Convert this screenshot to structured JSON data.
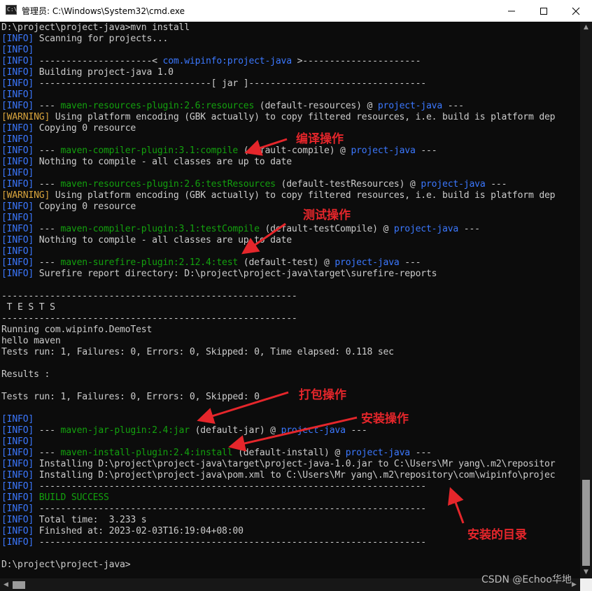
{
  "window": {
    "title": "管理员: C:\\Windows\\System32\\cmd.exe",
    "icon_label": "C:\\",
    "controls": [
      "minimize-icon",
      "maximize-icon",
      "close-icon"
    ]
  },
  "console": {
    "lines": [
      [
        {
          "t": "D:\\project\\project-java>mvn install",
          "c": ""
        }
      ],
      [
        {
          "t": "[INFO]",
          "c": "bl"
        },
        {
          "t": " Scanning for projects...",
          "c": ""
        }
      ],
      [
        {
          "t": "[INFO]",
          "c": "bl"
        }
      ],
      [
        {
          "t": "[INFO]",
          "c": "bl"
        },
        {
          "t": " ---------------------< ",
          "c": ""
        },
        {
          "t": "com.wipinfo:project-java",
          "c": "bl"
        },
        {
          "t": " >----------------------",
          "c": ""
        }
      ],
      [
        {
          "t": "[INFO]",
          "c": "bl"
        },
        {
          "t": " Building project-java 1.0",
          "c": ""
        }
      ],
      [
        {
          "t": "[INFO]",
          "c": "bl"
        },
        {
          "t": " --------------------------------[ jar ]---------------------------------",
          "c": ""
        }
      ],
      [
        {
          "t": "[INFO]",
          "c": "bl"
        }
      ],
      [
        {
          "t": "[INFO]",
          "c": "bl"
        },
        {
          "t": " --- ",
          "c": ""
        },
        {
          "t": "maven-resources-plugin:2.6:resources",
          "c": "gr"
        },
        {
          "t": " (default-resources) @ ",
          "c": ""
        },
        {
          "t": "project-java",
          "c": "bl"
        },
        {
          "t": " ---",
          "c": ""
        }
      ],
      [
        {
          "t": "[WARNING]",
          "c": "or"
        },
        {
          "t": " Using platform encoding (GBK actually) to copy filtered resources, i.e. build is platform dep",
          "c": ""
        }
      ],
      [
        {
          "t": "[INFO]",
          "c": "bl"
        },
        {
          "t": " Copying 0 resource",
          "c": ""
        }
      ],
      [
        {
          "t": "[INFO]",
          "c": "bl"
        }
      ],
      [
        {
          "t": "[INFO]",
          "c": "bl"
        },
        {
          "t": " --- ",
          "c": ""
        },
        {
          "t": "maven-compiler-plugin:3.1:compile",
          "c": "gr"
        },
        {
          "t": " (default-compile) @ ",
          "c": ""
        },
        {
          "t": "project-java",
          "c": "bl"
        },
        {
          "t": " ---",
          "c": ""
        }
      ],
      [
        {
          "t": "[INFO]",
          "c": "bl"
        },
        {
          "t": " Nothing to compile - all classes are up to date",
          "c": ""
        }
      ],
      [
        {
          "t": "[INFO]",
          "c": "bl"
        }
      ],
      [
        {
          "t": "[INFO]",
          "c": "bl"
        },
        {
          "t": " --- ",
          "c": ""
        },
        {
          "t": "maven-resources-plugin:2.6:testResources",
          "c": "gr"
        },
        {
          "t": " (default-testResources) @ ",
          "c": ""
        },
        {
          "t": "project-java",
          "c": "bl"
        },
        {
          "t": " ---",
          "c": ""
        }
      ],
      [
        {
          "t": "[WARNING]",
          "c": "or"
        },
        {
          "t": " Using platform encoding (GBK actually) to copy filtered resources, i.e. build is platform dep",
          "c": ""
        }
      ],
      [
        {
          "t": "[INFO]",
          "c": "bl"
        },
        {
          "t": " Copying 0 resource",
          "c": ""
        }
      ],
      [
        {
          "t": "[INFO]",
          "c": "bl"
        }
      ],
      [
        {
          "t": "[INFO]",
          "c": "bl"
        },
        {
          "t": " --- ",
          "c": ""
        },
        {
          "t": "maven-compiler-plugin:3.1:testCompile",
          "c": "gr"
        },
        {
          "t": " (default-testCompile) @ ",
          "c": ""
        },
        {
          "t": "project-java",
          "c": "bl"
        },
        {
          "t": " ---",
          "c": ""
        }
      ],
      [
        {
          "t": "[INFO]",
          "c": "bl"
        },
        {
          "t": " Nothing to compile - all classes are up to date",
          "c": ""
        }
      ],
      [
        {
          "t": "[INFO]",
          "c": "bl"
        }
      ],
      [
        {
          "t": "[INFO]",
          "c": "bl"
        },
        {
          "t": " --- ",
          "c": ""
        },
        {
          "t": "maven-surefire-plugin:2.12.4:test",
          "c": "gr"
        },
        {
          "t": " (default-test) @ ",
          "c": ""
        },
        {
          "t": "project-java",
          "c": "bl"
        },
        {
          "t": " ---",
          "c": ""
        }
      ],
      [
        {
          "t": "[INFO]",
          "c": "bl"
        },
        {
          "t": " Surefire report directory: D:\\project\\project-java\\target\\surefire-reports",
          "c": ""
        }
      ],
      [],
      [
        {
          "t": "-------------------------------------------------------",
          "c": ""
        }
      ],
      [
        {
          "t": " T E S T S",
          "c": ""
        }
      ],
      [
        {
          "t": "-------------------------------------------------------",
          "c": ""
        }
      ],
      [
        {
          "t": "Running com.wipinfo.DemoTest",
          "c": ""
        }
      ],
      [
        {
          "t": "hello maven",
          "c": ""
        }
      ],
      [
        {
          "t": "Tests run: 1, Failures: 0, Errors: 0, Skipped: 0, Time elapsed: 0.118 sec",
          "c": ""
        }
      ],
      [],
      [
        {
          "t": "Results :",
          "c": ""
        }
      ],
      [],
      [
        {
          "t": "Tests run: 1, Failures: 0, Errors: 0, Skipped: 0",
          "c": ""
        }
      ],
      [],
      [
        {
          "t": "[INFO]",
          "c": "bl"
        }
      ],
      [
        {
          "t": "[INFO]",
          "c": "bl"
        },
        {
          "t": " --- ",
          "c": ""
        },
        {
          "t": "maven-jar-plugin:2.4:jar",
          "c": "gr"
        },
        {
          "t": " (default-jar) @ ",
          "c": ""
        },
        {
          "t": "project-java",
          "c": "bl"
        },
        {
          "t": " ---",
          "c": ""
        }
      ],
      [
        {
          "t": "[INFO]",
          "c": "bl"
        }
      ],
      [
        {
          "t": "[INFO]",
          "c": "bl"
        },
        {
          "t": " --- ",
          "c": ""
        },
        {
          "t": "maven-install-plugin:2.4:install",
          "c": "gr"
        },
        {
          "t": " (default-install) @ ",
          "c": ""
        },
        {
          "t": "project-java",
          "c": "bl"
        },
        {
          "t": " ---",
          "c": ""
        }
      ],
      [
        {
          "t": "[INFO]",
          "c": "bl"
        },
        {
          "t": " Installing D:\\project\\project-java\\target\\project-java-1.0.jar to C:\\Users\\Mr yang\\.m2\\repositor",
          "c": ""
        }
      ],
      [
        {
          "t": "[INFO]",
          "c": "bl"
        },
        {
          "t": " Installing D:\\project\\project-java\\pom.xml to C:\\Users\\Mr yang\\.m2\\repository\\com\\wipinfo\\projec",
          "c": ""
        }
      ],
      [
        {
          "t": "[INFO]",
          "c": "bl"
        },
        {
          "t": " ------------------------------------------------------------------------",
          "c": ""
        }
      ],
      [
        {
          "t": "[INFO]",
          "c": "bl"
        },
        {
          "t": " BUILD SUCCESS",
          "c": "gr"
        }
      ],
      [
        {
          "t": "[INFO]",
          "c": "bl"
        },
        {
          "t": " ------------------------------------------------------------------------",
          "c": ""
        }
      ],
      [
        {
          "t": "[INFO]",
          "c": "bl"
        },
        {
          "t": " Total time:  3.233 s",
          "c": ""
        }
      ],
      [
        {
          "t": "[INFO]",
          "c": "bl"
        },
        {
          "t": " Finished at: 2023-02-03T16:19:04+08:00",
          "c": ""
        }
      ],
      [
        {
          "t": "[INFO]",
          "c": "bl"
        },
        {
          "t": " ------------------------------------------------------------------------",
          "c": ""
        }
      ],
      [],
      [
        {
          "t": "D:\\project\\project-java>",
          "c": ""
        }
      ]
    ]
  },
  "annotations": {
    "compile": "编译操作",
    "test": "测试操作",
    "package": "打包操作",
    "install": "安装操作",
    "install_dir": "安装的目录"
  },
  "watermark": "CSDN @Echoo华地",
  "colors": {
    "background": "#0c0c0c",
    "text": "#cccccc",
    "info_blue": "#3b78ff",
    "plugin_green": "#13a10e",
    "warning_orange": "#d7a33d",
    "annotation_red": "#e5262b"
  }
}
